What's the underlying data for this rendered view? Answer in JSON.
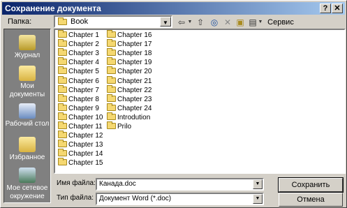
{
  "window": {
    "title": "Сохранение документа",
    "help_btn": "?",
    "close_btn": "✕"
  },
  "toolbar": {
    "folder_label": "Папка:",
    "folder_value": "Book",
    "back_icon": "⇦",
    "up_icon": "⇧",
    "search_web_icon": "◎",
    "delete_icon": "✕",
    "new_folder_icon": "▣",
    "views_icon": "▤",
    "tools_label": "Сервис ▾"
  },
  "places": [
    {
      "label": "Журнал",
      "icon": "history-icon"
    },
    {
      "label": "Мои документы",
      "icon": "my-documents-icon"
    },
    {
      "label": "Рабочий стол",
      "icon": "desktop-icon"
    },
    {
      "label": "Избранное",
      "icon": "favorites-icon"
    },
    {
      "label": "Мое сетевое окружение",
      "icon": "network-icon"
    }
  ],
  "files": {
    "col1": [
      "Chapter 1",
      "Chapter 2",
      "Chapter 3",
      "Chapter 4",
      "Chapter 5",
      "Chapter 6",
      "Chapter 7",
      "Chapter 8",
      "Chapter 9",
      "Chapter 10",
      "Chapter 11",
      "Chapter 12",
      "Chapter 13",
      "Chapter 14",
      "Chapter 15"
    ],
    "col2": [
      "Chapter 16",
      "Chapter 17",
      "Chapter 18",
      "Chapter 19",
      "Chapter 20",
      "Chapter 21",
      "Chapter 22",
      "Chapter 23",
      "Chapter 24",
      "Introdution",
      "Prilo"
    ]
  },
  "bottom": {
    "filename_label": "Имя файла:",
    "filename_value": "Канада.doc",
    "filetype_label": "Тип файла:",
    "filetype_value": "Документ Word (*.doc)",
    "save_label": "Сохранить",
    "cancel_label": "Отмена"
  }
}
